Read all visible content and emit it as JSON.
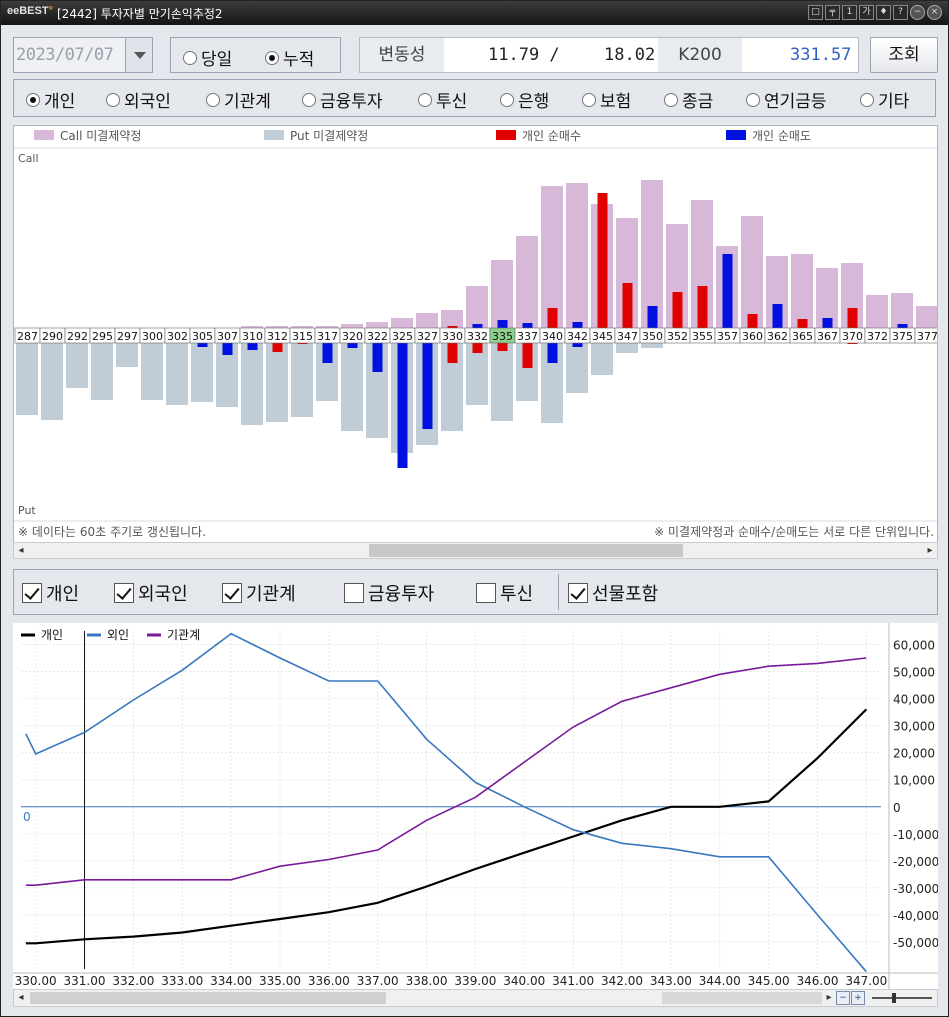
{
  "titlebar": {
    "logo": "eBEST",
    "title": "[2442] 투자자별 만기손익추정2",
    "buttons": [
      "□",
      "╤",
      "1",
      "가",
      "♦",
      "?"
    ]
  },
  "date": "2023/07/07",
  "period": {
    "options": [
      "당일",
      "누적"
    ],
    "selected": "누적"
  },
  "info": {
    "vol_label": "변동성",
    "vol1": "11.79 /",
    "vol2": "18.02",
    "k200_label": "K200",
    "k200_value": "331.57"
  },
  "query_button": "조회",
  "investors": {
    "options": [
      "개인",
      "외국인",
      "기관계",
      "금융투자",
      "투신",
      "은행",
      "보험",
      "종금",
      "연기금등",
      "기타"
    ],
    "selected": "개인"
  },
  "chart_data": [
    {
      "type": "bar",
      "legend": [
        "Call 미결제약정",
        "Put 미결제약정",
        "개인 순매수",
        "개인 순매도"
      ],
      "top_label": "Call",
      "bottom_label": "Put",
      "categories": [
        "287",
        "290",
        "292",
        "295",
        "297",
        "300",
        "302",
        "305",
        "307",
        "310",
        "312",
        "315",
        "317",
        "320",
        "322",
        "325",
        "327",
        "330",
        "332",
        "335",
        "337",
        "340",
        "342",
        "345",
        "347",
        "350",
        "352",
        "355",
        "357",
        "360",
        "362",
        "365",
        "367",
        "370",
        "372",
        "375",
        "377"
      ],
      "highlight": "335",
      "call_oi": [
        0,
        0,
        0,
        0,
        0,
        0,
        0,
        0,
        0,
        2,
        2,
        2,
        2,
        4,
        6,
        10,
        15,
        18,
        42,
        68,
        92,
        142,
        145,
        124,
        110,
        148,
        104,
        128,
        82,
        112,
        72,
        74,
        60,
        65,
        33,
        35,
        22
      ],
      "put_oi": [
        72,
        77,
        45,
        57,
        24,
        57,
        62,
        59,
        64,
        82,
        79,
        74,
        58,
        88,
        95,
        110,
        102,
        88,
        62,
        78,
        58,
        80,
        50,
        32,
        10,
        5,
        0,
        0,
        0,
        0,
        0,
        0,
        0,
        0,
        0,
        0,
        0
      ],
      "call_net_buy": [
        0,
        0,
        0,
        0,
        0,
        0,
        0,
        0,
        0,
        0,
        0,
        0,
        0,
        0,
        0,
        0,
        0,
        2,
        0,
        0,
        0,
        20,
        0,
        135,
        45,
        0,
        36,
        42,
        0,
        14,
        0,
        9,
        0,
        20,
        0,
        0,
        0
      ],
      "call_net_sell": [
        0,
        0,
        0,
        0,
        0,
        0,
        0,
        0,
        0,
        0,
        0,
        0,
        0,
        0,
        0,
        0,
        0,
        0,
        4,
        8,
        5,
        0,
        6,
        0,
        0,
        22,
        0,
        0,
        74,
        0,
        24,
        0,
        10,
        0,
        0,
        4,
        0
      ],
      "put_net_buy": [
        0,
        0,
        0,
        0,
        0,
        0,
        0,
        0,
        0,
        0,
        9,
        1,
        0,
        0,
        0,
        0,
        0,
        20,
        10,
        8,
        25,
        0,
        0,
        0,
        0,
        0,
        0,
        0,
        0,
        0,
        0,
        0,
        0,
        1,
        0,
        0,
        0
      ],
      "put_net_sell": [
        0,
        0,
        0,
        0,
        0,
        0,
        0,
        4,
        12,
        7,
        0,
        0,
        20,
        5,
        29,
        125,
        86,
        0,
        0,
        0,
        0,
        20,
        4,
        0,
        0,
        0,
        0,
        0,
        0,
        0,
        0,
        0,
        0,
        0,
        0,
        0,
        0
      ],
      "footer_left": "※ 데이타는 60초 주기로 갱신됩니다.",
      "footer_right": "※ 미결제약정과 순매수/순매도는 서로 다른 단위입니다."
    },
    {
      "type": "line",
      "x": [
        329.8,
        330.0,
        331.0,
        332.0,
        333.0,
        334.0,
        335.0,
        336.0,
        337.0,
        338.0,
        339.0,
        340.0,
        341.0,
        342.0,
        343.0,
        344.0,
        345.0,
        346.0,
        347.0
      ],
      "x_ticks": [
        "330.00",
        "331.00",
        "332.00",
        "333.00",
        "334.00",
        "335.00",
        "336.00",
        "337.00",
        "338.00",
        "339.00",
        "340.00",
        "341.00",
        "342.00",
        "343.00",
        "344.00",
        "345.00",
        "346.00",
        "347.00"
      ],
      "ylim": [
        -60000,
        65000
      ],
      "y_ticks": [
        "60,000",
        "50,000",
        "40,000",
        "30,000",
        "20,000",
        "10,000",
        "0",
        "-10,000",
        "-20,000",
        "-30,000",
        "-40,000",
        "-50,000"
      ],
      "zero_label": "0",
      "series": [
        {
          "name": "개인",
          "color": "#000000",
          "values": [
            -50500,
            -50500,
            -49000,
            -48000,
            -46500,
            -44000,
            -41500,
            -39000,
            -35500,
            -29500,
            -23000,
            -17000,
            -11000,
            -5000,
            0,
            0,
            2000,
            18000,
            36000
          ]
        },
        {
          "name": "외인",
          "color": "#3878c0",
          "values": [
            27000,
            19500,
            27500,
            39500,
            50500,
            64000,
            55000,
            46500,
            46500,
            25000,
            9000,
            0,
            -8500,
            -13500,
            -15500,
            -18500,
            -18500,
            -40000,
            -61000
          ]
        },
        {
          "name": "기관계",
          "color": "#7a1a9a",
          "values": [
            -29000,
            -29000,
            -27000,
            -27000,
            -27000,
            -27000,
            -22000,
            -19500,
            -16000,
            -5000,
            3500,
            16500,
            29500,
            39000,
            44000,
            49000,
            52000,
            53000,
            55000
          ]
        }
      ],
      "cursor_x": 331.0
    }
  ],
  "checkboxes": [
    {
      "label": "개인",
      "checked": true
    },
    {
      "label": "외국인",
      "checked": true
    },
    {
      "label": "기관계",
      "checked": true
    },
    {
      "label": "금융투자",
      "checked": false
    },
    {
      "label": "투신",
      "checked": false
    },
    {
      "label": "선물포함",
      "checked": true
    }
  ],
  "colors": {
    "call": "#d8b8d8",
    "put": "#c0ccd6",
    "buy": "#e00000",
    "sell": "#0010e0",
    "highlight": "#8cd08c"
  }
}
